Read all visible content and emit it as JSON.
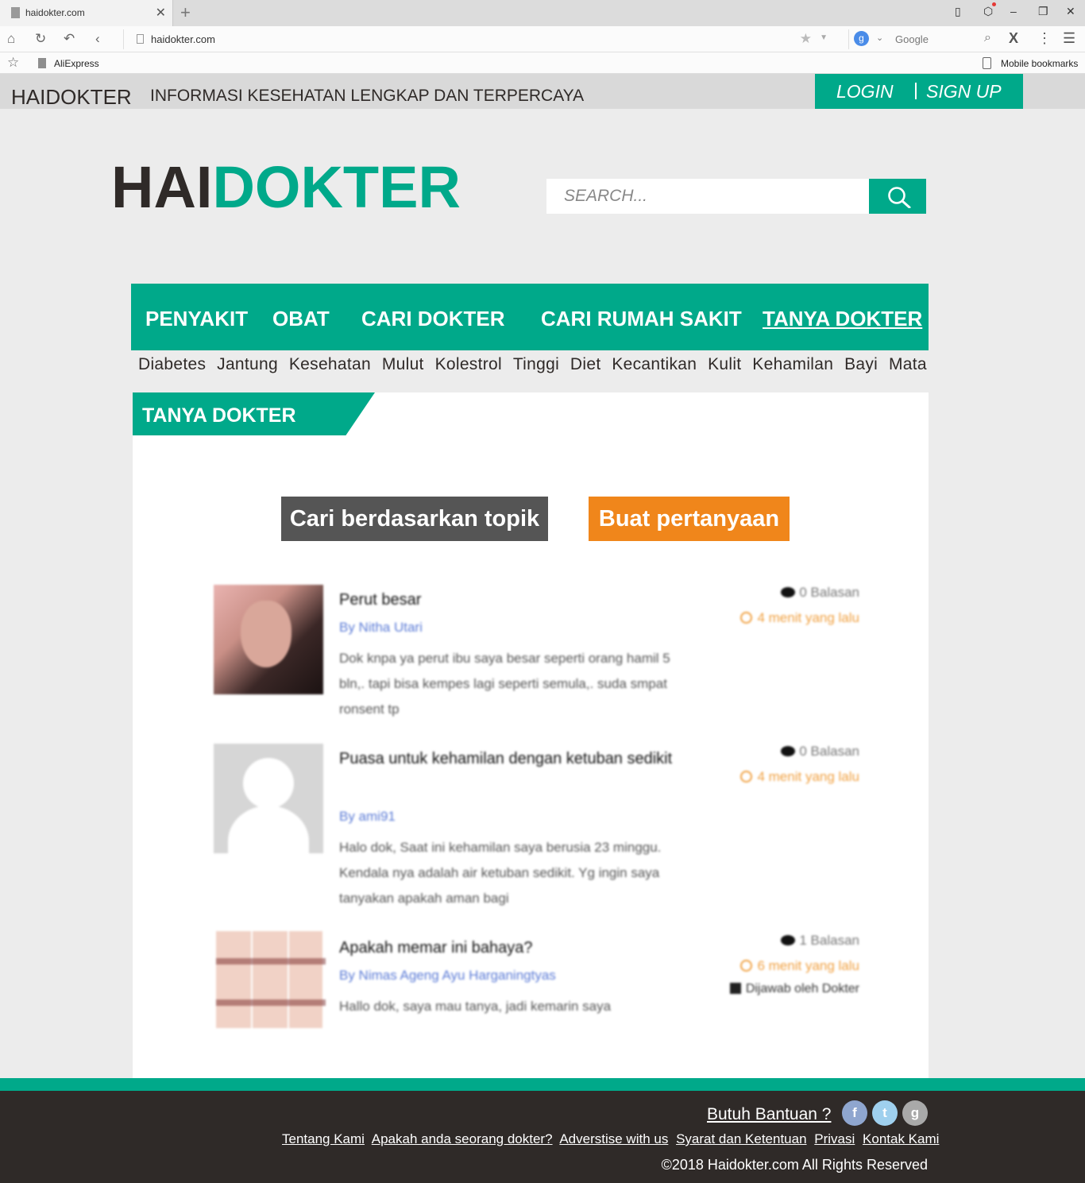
{
  "browser": {
    "tab_title": "haidokter.com",
    "url": "haidokter.com",
    "search_engine_placeholder": "Google",
    "bookmark_item": "AliExpress",
    "mobile_bookmarks": "Mobile bookmarks"
  },
  "topbar": {
    "brand": "HAIDOKTER",
    "tagline": "INFORMASI KESEHATAN LENGKAP DAN TERPERCAYA",
    "login": "LOGIN",
    "signup": "SIGN UP"
  },
  "logo": {
    "part1": "HAI",
    "part2": "DOKTER"
  },
  "search": {
    "placeholder": "SEARCH..."
  },
  "main_nav": [
    "PENYAKIT",
    "OBAT",
    "CARI DOKTER",
    "CARI RUMAH SAKIT",
    "TANYA DOKTER"
  ],
  "sub_nav": [
    "Diabetes",
    "Jantung",
    "Kesehatan",
    "Mulut",
    "Kolestrol",
    "Tinggi",
    "Diet",
    "Kecantikan",
    "Kulit",
    "Kehamilan",
    "Bayi",
    "Mata"
  ],
  "section": {
    "title": "TANYA DOKTER",
    "btn_topic": "Cari berdasarkan topik",
    "btn_ask": "Buat pertanyaan"
  },
  "questions": [
    {
      "title": "Perut besar",
      "author": "By Nitha Utari",
      "excerpt": "Dok knpa ya perut ibu saya besar seperti orang hamil 5 bln,. tapi bisa kempes lagi seperti semula,. suda smpat ronsent tp",
      "replies": "0 Balasan",
      "time": "4 menit yang lalu"
    },
    {
      "title": "Puasa untuk kehamilan dengan ketuban sedikit",
      "author": "By ami91",
      "excerpt": "Halo dok, Saat ini kehamilan saya berusia 23 minggu. Kendala nya adalah air ketuban sedikit. Yg ingin saya tanyakan apakah aman bagi",
      "replies": "0 Balasan",
      "time": "4 menit yang lalu"
    },
    {
      "title": "Apakah memar ini bahaya?",
      "author": "By Nimas Ageng Ayu Harganingtyas",
      "excerpt": "Hallo dok, saya mau tanya, jadi kemarin saya",
      "replies": "1 Balasan",
      "time": "6 menit yang lalu",
      "answered": "Dijawab oleh Dokter"
    }
  ],
  "footer": {
    "help": "Butuh Bantuan ?",
    "links": [
      "Tentang Kami",
      "Apakah anda seorang dokter?",
      "Adverstise with us",
      "Syarat dan Ketentuan",
      "Privasi",
      "Kontak Kami"
    ],
    "copyright": "©2018 Haidokter.com All Rights Reserved",
    "social_colors": {
      "facebook": "#8fa6cf",
      "twitter": "#9fd0ee",
      "google": "#a9a9a9"
    }
  },
  "colors": {
    "accent": "#00a98a",
    "dark": "#2f2a28",
    "orange": "#f0861b",
    "grey_button": "#555555"
  }
}
